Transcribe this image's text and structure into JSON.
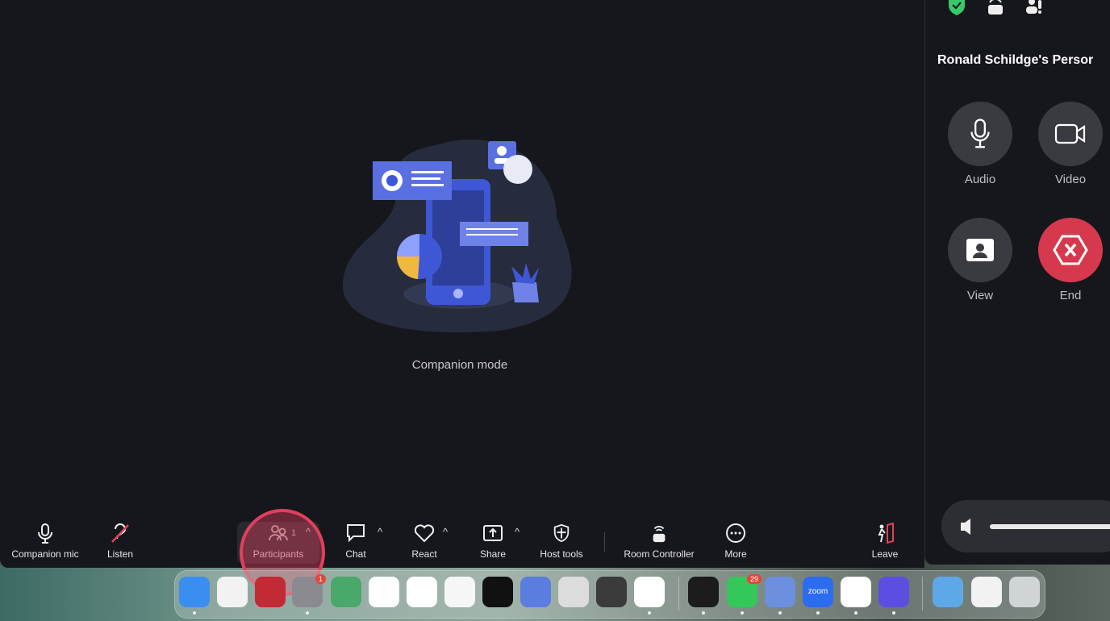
{
  "main": {
    "caption": "Companion mode"
  },
  "toolbar": {
    "companion_mic": "Companion mic",
    "listen": "Listen",
    "participants": "Participants",
    "participants_count": "1",
    "chat": "Chat",
    "react": "React",
    "share": "Share",
    "host_tools": "Host tools",
    "room_controller": "Room Controller",
    "more": "More",
    "leave": "Leave"
  },
  "side": {
    "title": "Ronald Schildge's Persor",
    "audio": "Audio",
    "video": "Video",
    "view": "View",
    "end": "End",
    "end_color": "#d6394d",
    "volume_level": 1.0
  },
  "dock": {
    "apps": [
      "Finder",
      "Launchpad",
      "Shield app",
      "System Settings",
      "Maps",
      "Photos",
      "News",
      "Freeform",
      "TV",
      "Simulator",
      "Mail app",
      "Sublime Text",
      "Chrome",
      "Terminal",
      "Messages",
      "Device app",
      "Zoom",
      "QuickTime",
      "Toolbox",
      "Applications",
      "Downloads",
      "Trash"
    ],
    "settings_badge": "1",
    "messages_badge": "29",
    "zoom_label": "zoom"
  }
}
